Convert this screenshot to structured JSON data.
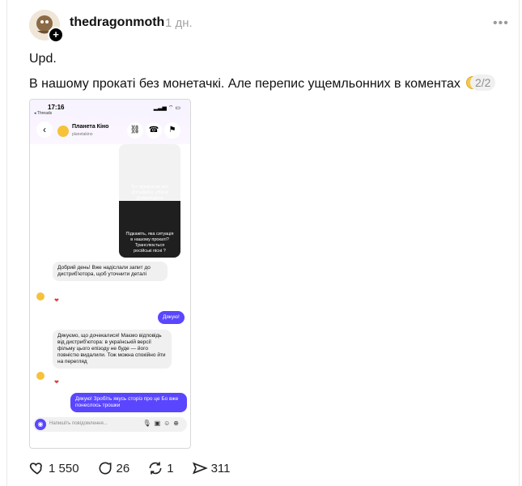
{
  "post": {
    "username": "thedragonmoth",
    "time": "1 дн.",
    "line1": "Upd.",
    "line2": "В нашому прокаті без монетачкі. Але перепис ущемльонних в коментах",
    "counter": "2/2",
    "stats": {
      "likes": "1 550",
      "comments": "26",
      "reposts": "1",
      "shares": "311"
    }
  },
  "phone": {
    "time": "17:16",
    "back_app": "◂ Threads",
    "chat_name": "Планета Кіно",
    "chat_handle": "planetakino",
    "image_caption1": "Тут прекрасно все @multiplex_official @planetakino",
    "image_caption2": "Підкажіть, яка ситуація в нашому прокаті? Транслюється російські пісні ?",
    "msg1": "Добрий день! Вже надіслали запит до дистриб'ютора, щоб уточнити деталі",
    "msg2": "Дякую!",
    "msg3": "Дякуємо, що дочекалися! Маємо відповідь від дистриб'ютора: в українській версії фільму цього епізоду не буде — його повністю видалили. Тож можна спокійно йти на перегляд",
    "msg4": "Дякую! Зробіть якусь сторіз про це Бо вже понеслось трошки",
    "composer_placeholder": "Напишіть повідомлення..."
  },
  "icons": [
    "more-icon",
    "heart-icon",
    "comment-icon",
    "repost-icon",
    "share-icon",
    "back-icon",
    "link-icon",
    "phone-icon",
    "flag-icon",
    "camera-icon"
  ]
}
